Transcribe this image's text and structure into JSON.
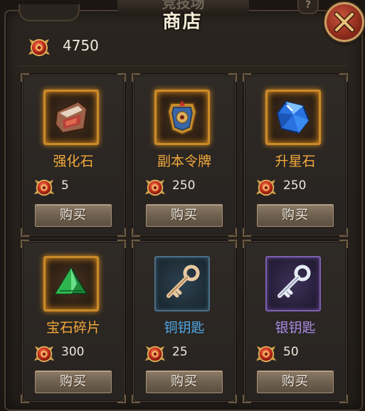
{
  "header": {
    "banner_text": "竞技场",
    "help_label": "?",
    "title": "商店"
  },
  "currency": {
    "icon": "red-dragon-coin-icon",
    "amount": "4750"
  },
  "colors": {
    "orange_name": "#f2a93b",
    "blue_name": "#4fa8e8",
    "purple_name": "#a98be6"
  },
  "items": [
    {
      "name": "强化石",
      "price": "5",
      "buy_label": "购买",
      "rarity": "orange",
      "icon": "forge-stone-icon"
    },
    {
      "name": "副本令牌",
      "price": "250",
      "buy_label": "购买",
      "rarity": "orange",
      "icon": "dungeon-token-icon"
    },
    {
      "name": "升星石",
      "price": "250",
      "buy_label": "购买",
      "rarity": "orange",
      "icon": "blue-gem-icon"
    },
    {
      "name": "宝石碎片",
      "price": "300",
      "buy_label": "购买",
      "rarity": "orange",
      "icon": "green-gem-icon"
    },
    {
      "name": "铜钥匙",
      "price": "25",
      "buy_label": "购买",
      "rarity": "blue",
      "icon": "copper-key-icon"
    },
    {
      "name": "银钥匙",
      "price": "50",
      "buy_label": "购买",
      "rarity": "purple",
      "icon": "silver-key-icon"
    }
  ]
}
